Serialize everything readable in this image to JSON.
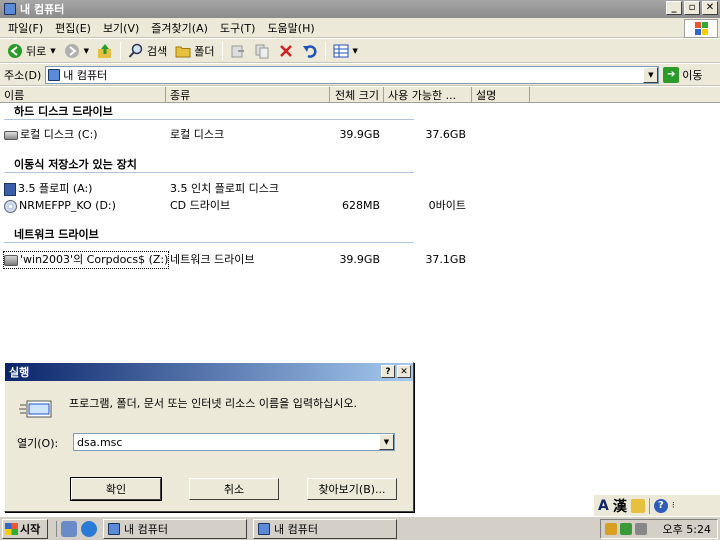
{
  "window": {
    "title": "내 컴퓨터",
    "controls": {
      "minimize": "_",
      "maximize": "▫",
      "close": "✕"
    }
  },
  "menu": [
    "파일(F)",
    "편집(E)",
    "보기(V)",
    "즐겨찾기(A)",
    "도구(T)",
    "도움말(H)"
  ],
  "toolbar": {
    "back_label": "뒤로",
    "search_label": "검색",
    "folders_label": "폴더"
  },
  "address": {
    "label": "주소(D)",
    "value": "내 컴퓨터",
    "go_label": "이동"
  },
  "columns": [
    "이름",
    "종류",
    "전체 크기",
    "사용 가능한 ...",
    "설명"
  ],
  "groups": [
    {
      "title": "하드 디스크 드라이브",
      "items": [
        {
          "name": "로컬 디스크 (C:)",
          "type": "로컬 디스크",
          "total": "39.9GB",
          "free": "37.6GB",
          "icon": "hard-drive-icon"
        }
      ]
    },
    {
      "title": "이동식 저장소가 있는 장치",
      "items": [
        {
          "name": "3.5 플로피 (A:)",
          "type": "3.5 인치 플로피 디스크",
          "total": "",
          "free": "",
          "icon": "floppy-icon"
        },
        {
          "name": "NRMEFPP_KO (D:)",
          "type": "CD 드라이브",
          "total": "628MB",
          "free": "0바이트",
          "icon": "cd-drive-icon"
        }
      ]
    },
    {
      "title": "네트워크 드라이브",
      "items": [
        {
          "name": "'win2003'의 Corpdocs$ (Z:)",
          "type": "네트워크 드라이브",
          "total": "39.9GB",
          "free": "37.1GB",
          "icon": "network-drive-icon"
        }
      ]
    }
  ],
  "run_dialog": {
    "title": "실행",
    "help": "?",
    "close": "✕",
    "description": "프로그램, 폴더, 문서 또는 인터넷 리소스 이름을 입력하십시오.",
    "open_label": "열기(O):",
    "open_value": "dsa.msc",
    "ok_label": "확인",
    "cancel_label": "취소",
    "browse_label": "찾아보기(B)..."
  },
  "langbar": {
    "a": "A",
    "hanja": "漢",
    "help": "?"
  },
  "taskbar": {
    "start_label": "시작",
    "tasks": [
      "내 컴퓨터",
      "내 컴퓨터"
    ],
    "clock": "오후 5:24"
  }
}
